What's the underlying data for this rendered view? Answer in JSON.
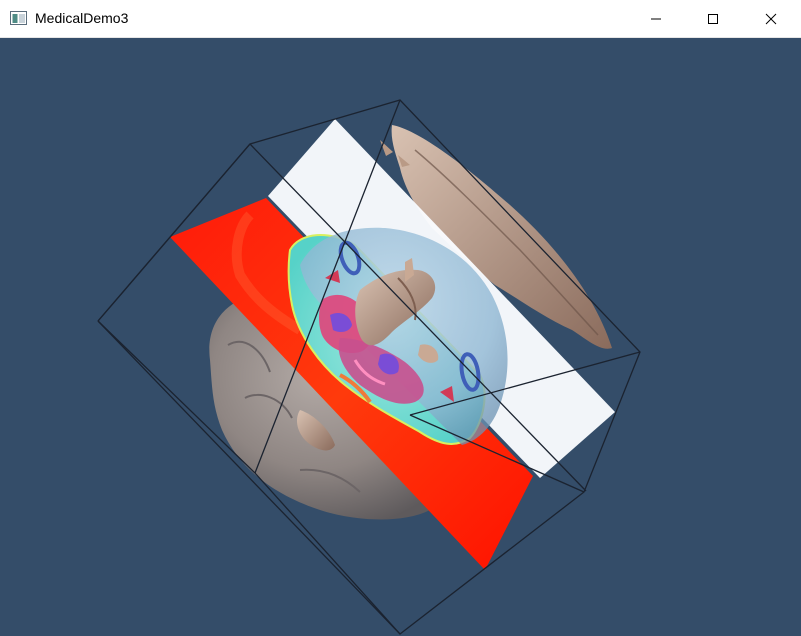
{
  "window": {
    "title": "MedicalDemo3",
    "controls": {
      "minimize": "minimize-icon",
      "maximize": "maximize-icon",
      "close": "close-icon"
    }
  },
  "colors": {
    "viewport_background": "#344d69",
    "titlebar_background": "#ffffff",
    "outline_box": "#1b2330",
    "axial_plane": "#ff2a0a",
    "sagittal_plane": "#fafcff",
    "skin_surface": "#9a8f8b",
    "bone_surface": "#b89a87"
  }
}
